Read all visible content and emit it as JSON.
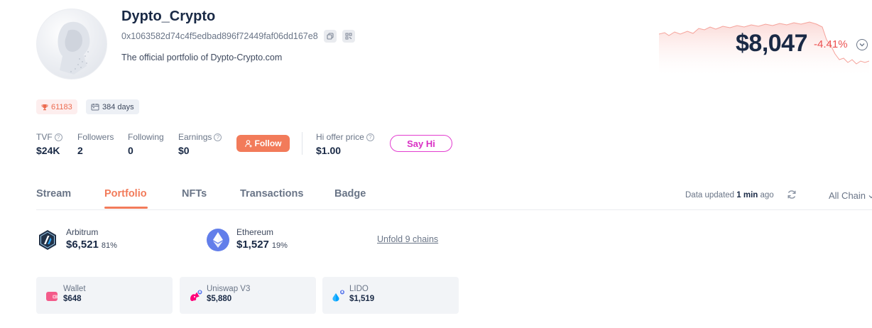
{
  "profile": {
    "name": "Dypto_Crypto",
    "address": "0x1063582d74c4f5edbad896f72449faf06dd167e8",
    "bio": "The official portfolio of Dypto-Crypto.com"
  },
  "net_worth": {
    "value": "$8,047",
    "change": "-4.41%",
    "change_color": "#ec5151"
  },
  "badges": {
    "rank": "61183",
    "days": "384 days"
  },
  "stats": {
    "tvf": {
      "label": "TVF",
      "value": "$24K"
    },
    "followers": {
      "label": "Followers",
      "value": "2"
    },
    "following": {
      "label": "Following",
      "value": "0"
    },
    "earnings": {
      "label": "Earnings",
      "value": "$0"
    },
    "hi_offer": {
      "label": "Hi offer price",
      "value": "$1.00"
    }
  },
  "buttons": {
    "follow": "Follow",
    "say_hi": "Say Hi"
  },
  "tabs": [
    {
      "label": "Stream",
      "active": false
    },
    {
      "label": "Portfolio",
      "active": true
    },
    {
      "label": "NFTs",
      "active": false
    },
    {
      "label": "Transactions",
      "active": false
    },
    {
      "label": "Badge",
      "active": false
    }
  ],
  "data_updated": {
    "prefix": "Data updated",
    "time": "1 min",
    "suffix": "ago"
  },
  "chain_filter": "All Chain",
  "chains": [
    {
      "name": "Arbitrum",
      "value": "$6,521",
      "percent": "81%",
      "icon": "arbitrum-logo"
    },
    {
      "name": "Ethereum",
      "value": "$1,527",
      "percent": "19%",
      "icon": "ethereum-logo"
    }
  ],
  "unfold": "Unfold 9 chains",
  "protocols": [
    {
      "name": "Wallet",
      "value": "$648",
      "icon": "wallet-icon"
    },
    {
      "name": "Uniswap V3",
      "value": "$5,880",
      "icon": "uniswap-icon"
    },
    {
      "name": "LIDO",
      "value": "$1,519",
      "icon": "lido-icon"
    }
  ],
  "colors": {
    "accent": "#f27b5a",
    "say_hi": "#d92fc4",
    "negative": "#ec5151",
    "text": "#192945",
    "muted": "#6a7587"
  }
}
